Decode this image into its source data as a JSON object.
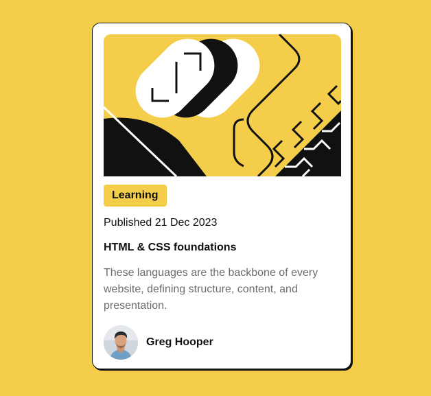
{
  "colors": {
    "background": "#F4CE4B",
    "card": "#FFFFFF",
    "ink": "#111111",
    "muted": "#6B6B6B"
  },
  "card": {
    "badge": "Learning",
    "published": "Published 21 Dec 2023",
    "title": "HTML & CSS foundations",
    "description": "These languages are the backbone of every website, defining structure, content, and presentation.",
    "author": {
      "name": "Greg Hooper",
      "avatar_icon": "user-portrait"
    },
    "hero_icon": "abstract-illustration"
  }
}
